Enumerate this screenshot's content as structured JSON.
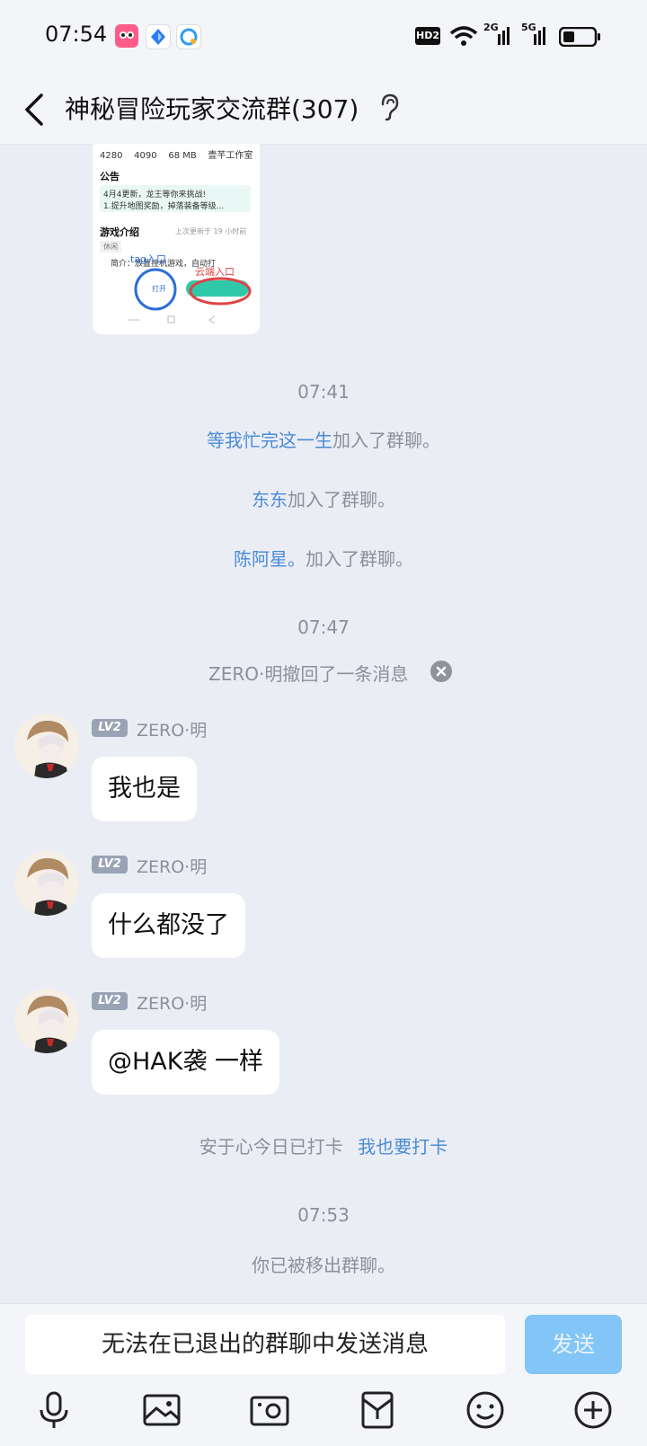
{
  "status_bar": {
    "time": "07:54",
    "hd_label": "HD2",
    "network_1": "2G",
    "network_2": "5G"
  },
  "header": {
    "title": "神秘冒险玩家交流群(307)"
  },
  "screenshot_image": {
    "stats": "4280    4090    68 MB    壹芊工作室",
    "announcement_title": "公告",
    "announcement_line1": "4月4更新，龙王等你来挑战!",
    "announcement_line2": "1.提升地图奖励，掉落装备等级...",
    "intro_title": "游戏介绍",
    "intro_updated": "上次更新于 19 小时前",
    "intro_tag": "休闲",
    "intro_text": "简介：放置挂机游戏，自动打",
    "tag_entry_label": "tag入口",
    "cloud_entry_label": "云端入口",
    "open_button": "打开"
  },
  "messages": {
    "time_1": "07:41",
    "join_1_name": "等我忙完这一生",
    "join_1_suffix": "加入了群聊。",
    "join_2_name": "东东",
    "join_2_suffix": "加入了群聊。",
    "join_3_name": "陈阿星。",
    "join_3_suffix": "加入了群聊。",
    "time_2": "07:47",
    "recall_text": "ZERO·明撤回了一条消息",
    "level_badge": "LV2",
    "sender_name": "ZERO·明",
    "msg_1": "我也是",
    "msg_2": "什么都没了",
    "msg_3": "@HAK袭 一样",
    "checkin_text": "安于心今日已打卡",
    "checkin_link": "我也要打卡",
    "time_3": "07:53",
    "removed_text": "你已被移出群聊。"
  },
  "input_bar": {
    "disabled_text": "无法在已退出的群聊中发送消息",
    "send_label": "发送"
  },
  "colors": {
    "background": "#ebedf5",
    "link": "#4a8bd6",
    "send_button": "#84c5f7"
  }
}
